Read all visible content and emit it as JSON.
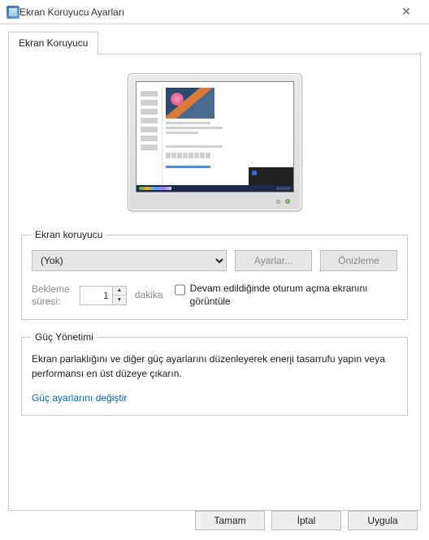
{
  "window": {
    "title": "Ekran Koruyucu Ayarları"
  },
  "tab": {
    "label": "Ekran Koruyucu"
  },
  "screensaver_section": {
    "legend": "Ekran koruyucu",
    "dropdown_value": "(Yok)",
    "settings_button": "Ayarlar...",
    "preview_button": "Önizleme",
    "wait_label": "Bekleme\nsüresi:",
    "wait_value": "1",
    "wait_unit": "dakika",
    "resume_checkbox_label": "Devam edildiğinde oturum açma ekranını görüntüle",
    "resume_checked": false
  },
  "power_section": {
    "legend": "Güç Yönetimi",
    "description": "Ekran parlaklığını ve diğer güç ayarlarını düzenleyerek enerji tasarrufu yapın veya performansı en üst düzeye çıkarın.",
    "link": "Güç ayarlarını değiştir"
  },
  "buttons": {
    "ok": "Tamam",
    "cancel": "İptal",
    "apply": "Uygula"
  }
}
